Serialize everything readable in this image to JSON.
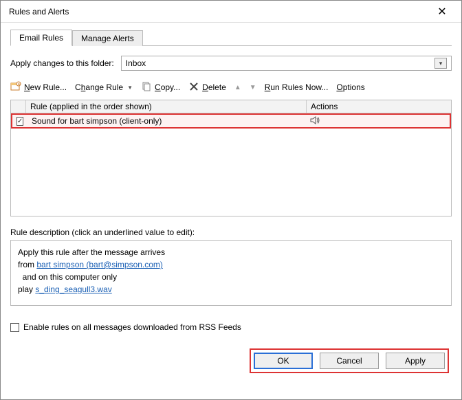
{
  "window": {
    "title": "Rules and Alerts"
  },
  "tabs": {
    "email_rules": "Email Rules",
    "manage_alerts": "Manage Alerts"
  },
  "folder": {
    "label": "Apply changes to this folder:",
    "selected": "Inbox"
  },
  "toolbar": {
    "new_rule": "New Rule...",
    "change_rule": "Change Rule",
    "copy": "Copy...",
    "delete": "Delete",
    "run_rules_now": "Run Rules Now...",
    "options": "Options"
  },
  "list": {
    "header_rule": "Rule (applied in the order shown)",
    "header_actions": "Actions",
    "rows": [
      {
        "checked": true,
        "name": "Sound for bart simpson  (client-only)",
        "action_icon": "speaker"
      }
    ]
  },
  "description": {
    "label": "Rule description (click an underlined value to edit):",
    "line1": "Apply this rule after the message arrives",
    "line2_prefix": "from ",
    "line2_link": "bart simpson (bart@simpson.com)",
    "line3": "  and on this computer only",
    "line4_prefix": "play ",
    "line4_link": "s_ding_seagull3.wav"
  },
  "rss": {
    "label": "Enable rules on all messages downloaded from RSS Feeds"
  },
  "buttons": {
    "ok": "OK",
    "cancel": "Cancel",
    "apply": "Apply"
  }
}
